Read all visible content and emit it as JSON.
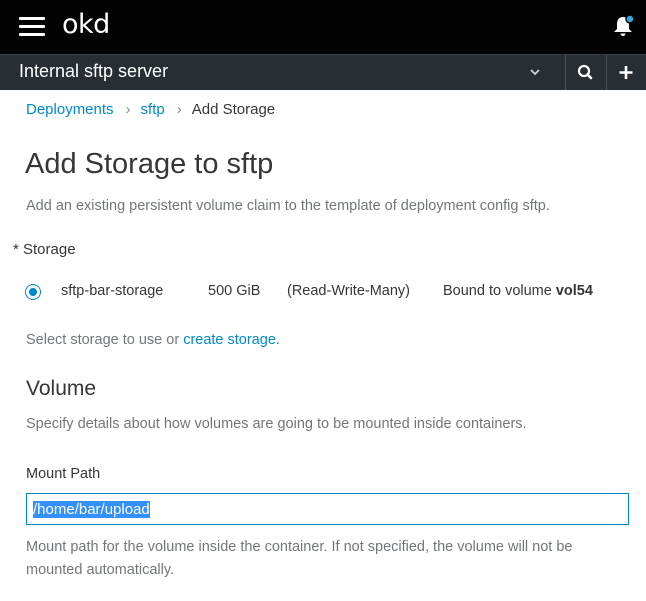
{
  "header": {
    "logo_text": "okd",
    "notification_dot_color": "#39a5dc"
  },
  "project_bar": {
    "project_name": "Internal sftp server"
  },
  "breadcrumb": {
    "items": [
      "Deployments",
      "sftp"
    ],
    "current": "Add Storage"
  },
  "page": {
    "title": "Add Storage to sftp",
    "subtitle": "Add an existing persistent volume claim to the template of deployment config sftp."
  },
  "storage": {
    "label": "* Storage",
    "options": [
      {
        "name": "sftp-bar-storage",
        "size": "500 GiB",
        "mode": "(Read-Write-Many)",
        "bound_prefix": "Bound to volume",
        "volume": "vol54",
        "selected": true
      }
    ],
    "help_prefix": "Select storage to use or",
    "help_link": "create storage."
  },
  "volume": {
    "heading": "Volume",
    "help": "Specify details about how volumes are going to be mounted inside containers.",
    "mount_path_label": "Mount Path",
    "mount_path_value": "/home/bar/upload",
    "mount_path_help": "Mount path for the volume inside the container. If not specified, the volume will not be mounted automatically."
  },
  "colors": {
    "accent": "#0088ce",
    "masthead": "#030303",
    "project_bar": "#292e34"
  }
}
